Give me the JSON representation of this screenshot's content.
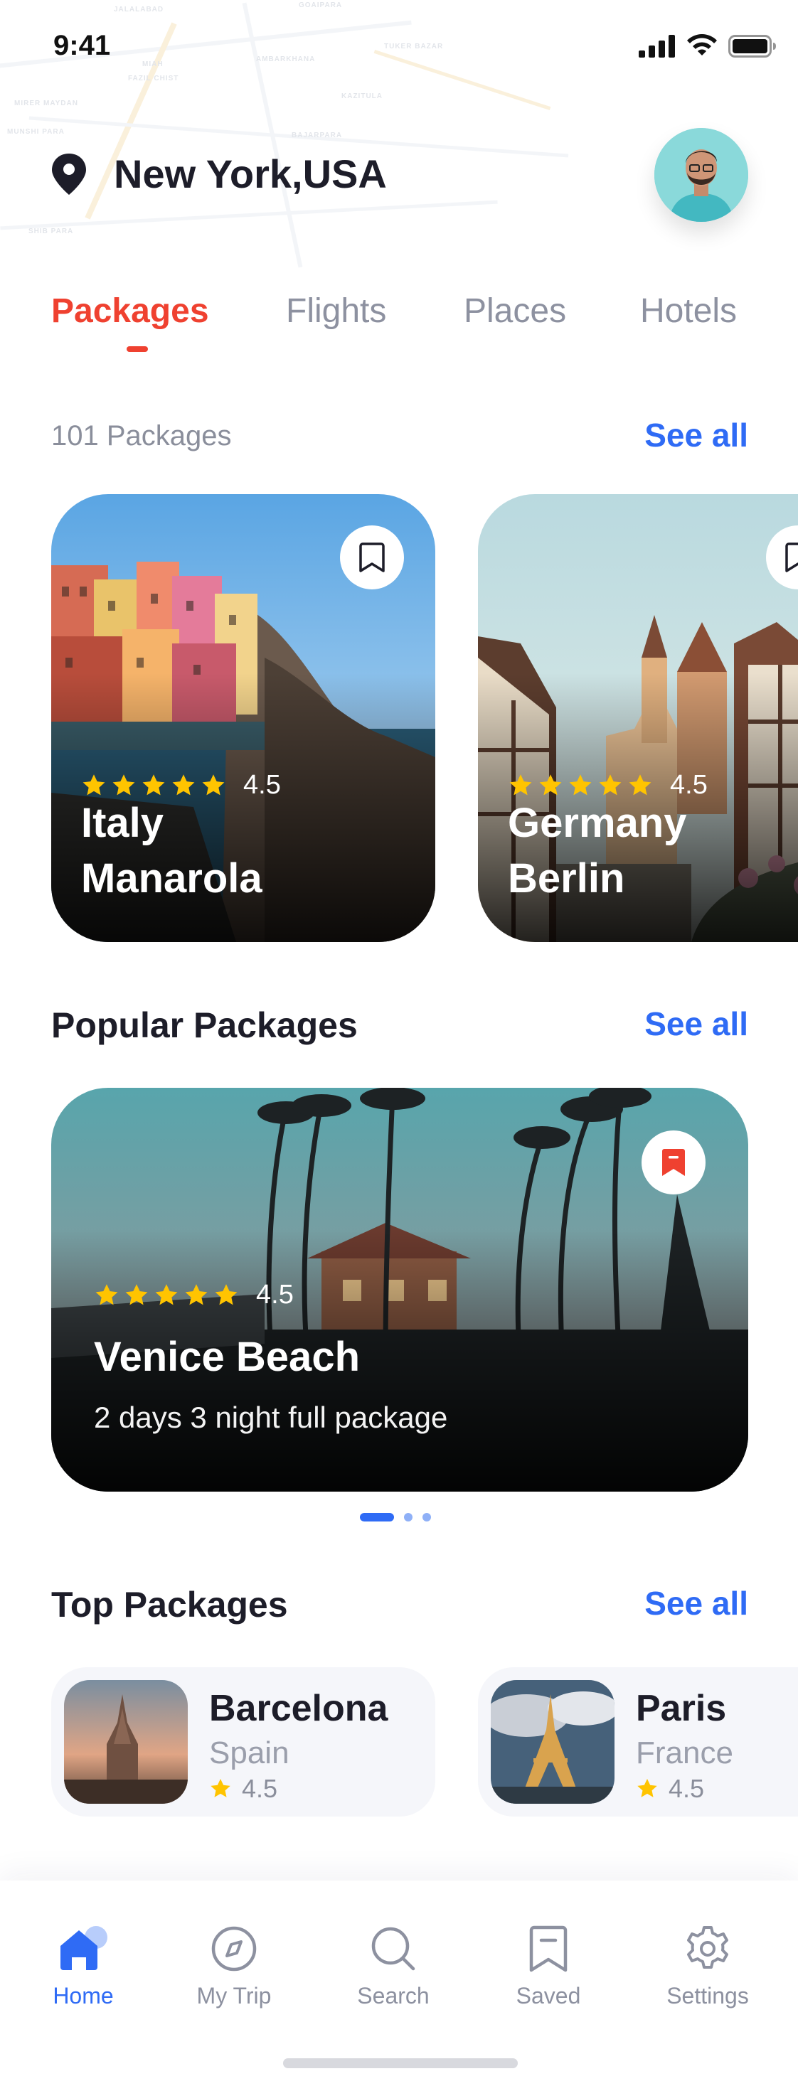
{
  "status_bar": {
    "time": "9:41"
  },
  "location": {
    "text": "New York,USA"
  },
  "tabs": [
    {
      "label": "Packages",
      "active": true
    },
    {
      "label": "Flights",
      "active": false
    },
    {
      "label": "Places",
      "active": false
    },
    {
      "label": "Hotels",
      "active": false
    }
  ],
  "packages_section": {
    "count_label": "101 Packages",
    "see_all": "See all",
    "cards": [
      {
        "rating": "4.5",
        "line1": "Italy",
        "line2": "Manarola"
      },
      {
        "rating": "4.5",
        "line1": "Germany",
        "line2": "Berlin"
      }
    ]
  },
  "popular_section": {
    "title": "Popular Packages",
    "see_all": "See all",
    "card": {
      "rating": "4.5",
      "title": "Venice Beach",
      "subtitle": "2 days 3 night full package"
    }
  },
  "top_section": {
    "title": "Top Packages",
    "see_all": "See all",
    "items": [
      {
        "city": "Barcelona",
        "country": "Spain",
        "rating": "4.5"
      },
      {
        "city": "Paris",
        "country": "France",
        "rating": "4.5"
      }
    ]
  },
  "nav": [
    {
      "label": "Home",
      "icon": "home-icon",
      "active": true
    },
    {
      "label": "My Trip",
      "icon": "compass-icon",
      "active": false
    },
    {
      "label": "Search",
      "icon": "search-icon",
      "active": false
    },
    {
      "label": "Saved",
      "icon": "bookmark-icon",
      "active": false
    },
    {
      "label": "Settings",
      "icon": "gear-icon",
      "active": false
    }
  ],
  "colors": {
    "accent_red": "#ef4130",
    "accent_blue": "#2f6bf5",
    "star": "#ffc400"
  }
}
